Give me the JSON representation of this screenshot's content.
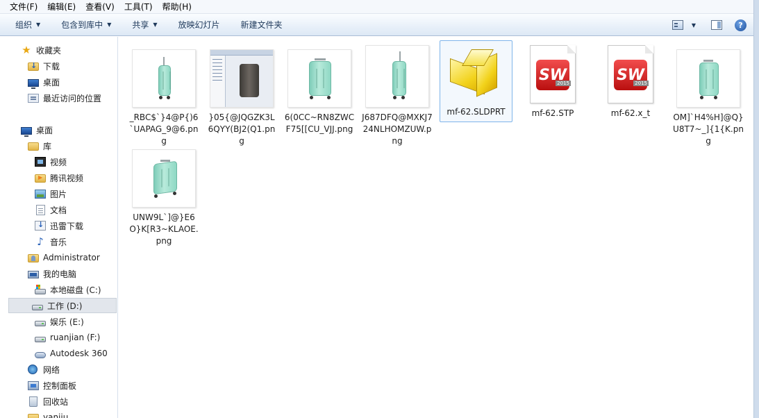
{
  "menubar": {
    "items": [
      "文件(F)",
      "编辑(E)",
      "查看(V)",
      "工具(T)",
      "帮助(H)"
    ]
  },
  "toolbar": {
    "organize": "组织",
    "include_library": "包含到库中",
    "share": "共享",
    "slideshow": "放映幻灯片",
    "new_folder": "新建文件夹",
    "help": "?"
  },
  "nav": {
    "favorites": "收藏夹",
    "downloads": "下载",
    "desktop_fav": "桌面",
    "recent": "最近访问的位置",
    "desktop": "桌面",
    "library": "库",
    "videos": "视频",
    "tencent_video": "腾讯视频",
    "pictures": "图片",
    "documents": "文档",
    "thunder": "迅雷下载",
    "music": "音乐",
    "administrator": "Administrator",
    "computer": "我的电脑",
    "drive_c": "本地磁盘 (C:)",
    "drive_d": "工作 (D:)",
    "drive_e": "娱乐 (E:)",
    "drive_f": "ruanjian (F:)",
    "autodesk": "Autodesk 360",
    "network": "网络",
    "control_panel": "控制面板",
    "recycle_bin": "回收站",
    "partial_item": "yaniju"
  },
  "files": [
    {
      "name": "_RBC$`}4@P{)6`UAPAG_9@6.png",
      "type": "png-side"
    },
    {
      "name": "}05{@JQGZK3L6QYY(BJ2(Q1.png",
      "type": "png-cad"
    },
    {
      "name": "6(0CC~RN8ZWCF75[[CU_VJJ.png",
      "type": "png-front"
    },
    {
      "name": "J687DFQ@MXKJ724NLHOMZUW.png",
      "type": "png-side2"
    },
    {
      "name": "mf-62.SLDPRT",
      "type": "sldprt"
    },
    {
      "name": "mf-62.STP",
      "type": "sw"
    },
    {
      "name": "mf-62.x_t",
      "type": "sw"
    },
    {
      "name": "OM]`H4%H]@Q}U8T7~_]{1{K.png",
      "type": "png-front2"
    },
    {
      "name": "UNW9L`]@}E6O}K[R3~KLAOE.png",
      "type": "png-persp"
    }
  ],
  "sw_icon": {
    "logo": "SW",
    "year": "2015"
  }
}
